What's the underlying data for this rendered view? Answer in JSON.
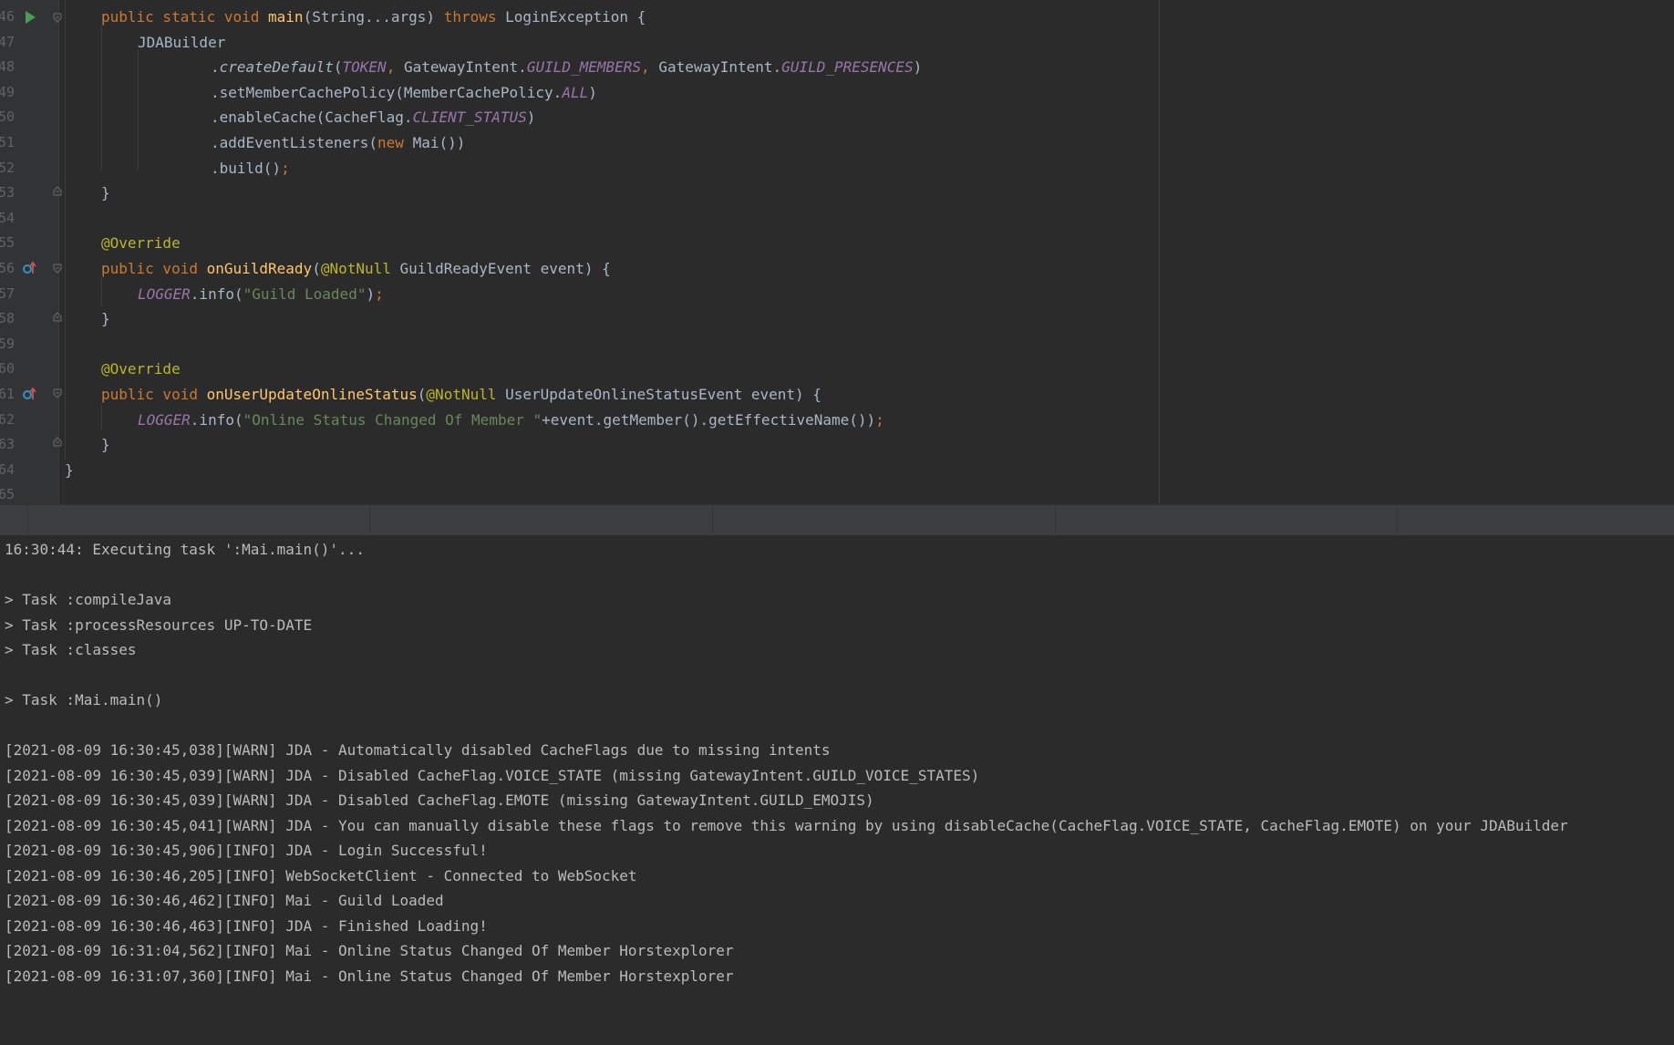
{
  "editor": {
    "lines": [
      {
        "num": "46",
        "tokens": [
          [
            "kw",
            "public static void "
          ],
          [
            "fn",
            "main"
          ],
          [
            "",
            "(String...args) "
          ],
          [
            "kw",
            "throws "
          ],
          [
            "",
            "LoginException {"
          ]
        ]
      },
      {
        "num": "47",
        "tokens": [
          [
            "",
            "JDABuilder"
          ]
        ]
      },
      {
        "num": "48",
        "tokens": [
          [
            "",
            ".  "
          ],
          [
            "it",
            "createDefault"
          ],
          [
            "",
            "("
          ],
          [
            "st",
            "TOKEN"
          ],
          [
            "kw",
            ", "
          ],
          [
            "",
            "GatewayIntent."
          ],
          [
            "st",
            "GUILD_MEMBERS"
          ],
          [
            "kw",
            ", "
          ],
          [
            "",
            "GatewayIntent."
          ],
          [
            "st",
            "GUILD_PRESENCES"
          ],
          [
            "",
            ")"
          ]
        ]
      },
      {
        "num": "49",
        "tokens": [
          [
            "",
            ".setMemberCachePolicy(MemberCachePolicy."
          ],
          [
            "st",
            "ALL"
          ],
          [
            "",
            ")"
          ]
        ]
      },
      {
        "num": "50",
        "tokens": [
          [
            "",
            ".enableCache(CacheFlag."
          ],
          [
            "st",
            "CLIENT_STATUS"
          ],
          [
            "",
            ")"
          ]
        ]
      },
      {
        "num": "51",
        "tokens": [
          [
            "",
            ".addEventListeners("
          ],
          [
            "kw",
            "new "
          ],
          [
            "",
            "Mai())"
          ]
        ]
      },
      {
        "num": "52",
        "tokens": [
          [
            "",
            ".build()"
          ],
          [
            "kw",
            ";"
          ]
        ]
      },
      {
        "num": "53",
        "tokens": [
          [
            "",
            "}"
          ]
        ]
      },
      {
        "num": "54",
        "tokens": []
      },
      {
        "num": "55",
        "tokens": [
          [
            "ann",
            "@Override"
          ]
        ]
      },
      {
        "num": "56",
        "tokens": [
          [
            "kw",
            "public void "
          ],
          [
            "fn",
            "onGuildReady"
          ],
          [
            "",
            "("
          ],
          [
            "ann",
            "@NotNull "
          ],
          [
            "",
            "GuildReadyEvent event) {"
          ]
        ]
      },
      {
        "num": "57",
        "tokens": [
          [
            "st",
            "LOGGER"
          ],
          [
            "",
            ".info("
          ],
          [
            "str",
            "\"Guild Loaded\""
          ],
          [
            "",
            ")"
          ],
          [
            "kw",
            ";"
          ]
        ]
      },
      {
        "num": "58",
        "tokens": [
          [
            "",
            "}"
          ]
        ]
      },
      {
        "num": "59",
        "tokens": []
      },
      {
        "num": "60",
        "tokens": [
          [
            "ann",
            "@Override"
          ]
        ]
      },
      {
        "num": "61",
        "tokens": [
          [
            "kw",
            "public void "
          ],
          [
            "fn",
            "onUserUpdateOnlineStatus"
          ],
          [
            "",
            "("
          ],
          [
            "ann",
            "@NotNull "
          ],
          [
            "",
            "UserUpdateOnlineStatusEvent event) {"
          ]
        ]
      },
      {
        "num": "62",
        "tokens": [
          [
            "st",
            "LOGGER"
          ],
          [
            "",
            ".info("
          ],
          [
            "str",
            "\"Online Status Changed Of Member \""
          ],
          [
            "",
            "+event.getMember().getEffectiveName())"
          ],
          [
            "kw",
            ";"
          ]
        ]
      },
      {
        "num": "63",
        "tokens": [
          [
            "",
            "}"
          ]
        ]
      },
      {
        "num": "64",
        "tokens": [
          [
            "",
            "}"
          ]
        ]
      },
      {
        "num": "65",
        "tokens": []
      }
    ]
  },
  "console": {
    "lines": [
      "16:30:44: Executing task ':Mai.main()'...",
      "",
      "> Task :compileJava",
      "> Task :processResources UP-TO-DATE",
      "> Task :classes",
      "",
      "> Task :Mai.main()",
      "",
      "[2021-08-09 16:30:45,038][WARN] JDA - Automatically disabled CacheFlags due to missing intents",
      "[2021-08-09 16:30:45,039][WARN] JDA - Disabled CacheFlag.VOICE_STATE (missing GatewayIntent.GUILD_VOICE_STATES)",
      "[2021-08-09 16:30:45,039][WARN] JDA - Disabled CacheFlag.EMOTE (missing GatewayIntent.GUILD_EMOJIS)",
      "[2021-08-09 16:30:45,041][WARN] JDA - You can manually disable these flags to remove this warning by using disableCache(CacheFlag.VOICE_STATE, CacheFlag.EMOTE) on your JDABuilder",
      "[2021-08-09 16:30:45,906][INFO] JDA - Login Successful!",
      "[2021-08-09 16:30:46,205][INFO] WebSocketClient - Connected to WebSocket",
      "[2021-08-09 16:30:46,462][INFO] Mai - Guild Loaded",
      "[2021-08-09 16:30:46,463][INFO] JDA - Finished Loading!",
      "[2021-08-09 16:31:04,562][INFO] Mai - Online Status Changed Of Member Horstexplorer",
      "[2021-08-09 16:31:07,360][INFO] Mai - Online Status Changed Of Member Horstexplorer"
    ]
  },
  "colors": {
    "background": "#2b2b2b",
    "keyword": "#cc7832",
    "method": "#ffc66d",
    "static_field": "#9876aa",
    "string": "#6a8759",
    "annotation": "#bbb529",
    "run_icon": "#499c54",
    "override_icon": "#3592c4"
  },
  "icons": [
    "run-icon",
    "override-icon",
    "fold-icon"
  ]
}
